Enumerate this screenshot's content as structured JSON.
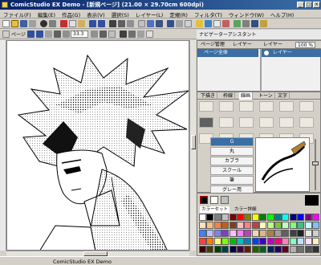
{
  "window": {
    "title": "ComicStudio EX Demo - [新規ページ] (21.00 × 29.70cm 600dpi)",
    "minimize": "_",
    "maximize": "□",
    "close": "×"
  },
  "menu": [
    "ファイル(F)",
    "編集(E)",
    "作品(G)",
    "表示(V)",
    "選択(S)",
    "レイヤー(L)",
    "定規(R)",
    "フィルタ(T)",
    "ウィンドウ(W)",
    "ヘルプ(H)"
  ],
  "toolbar2": {
    "page_label": "ページ",
    "zoom": "33.3"
  },
  "layer_panel": {
    "header": "ページ管理 レイヤー",
    "tab_navigator": "ナビゲーター",
    "tab_assistant": "アシスタント",
    "tab_page_mgmt": "ページ管理",
    "tab_layer": "レイヤー",
    "tab_layer2": "レイヤー",
    "zoom": "100 %",
    "page_item": "ページ全体",
    "layer_item": "レイヤー"
  },
  "tool_panel": {
    "tabs": [
      "下描き",
      "枠線",
      "線画",
      "トーン",
      "文字"
    ],
    "list": [
      "G",
      "丸",
      "カブラ",
      "スクール",
      "筆",
      "グレー用"
    ]
  },
  "color_panel": {
    "tab_set": "カラーセット",
    "tab_detail": "カラー詳細",
    "palette": [
      "#ffffff",
      "#000000",
      "#808080",
      "#c0c0c0",
      "#800000",
      "#ff0000",
      "#808000",
      "#ffff00",
      "#008000",
      "#00ff00",
      "#008080",
      "#00ffff",
      "#000080",
      "#0000ff",
      "#800080",
      "#ff00ff",
      "#ffe0c0",
      "#ffc080",
      "#ff8040",
      "#c06020",
      "#804020",
      "#ffc0c0",
      "#ff8080",
      "#c04040",
      "#ffffc0",
      "#c0ff80",
      "#80c040",
      "#c0ffc0",
      "#80ff80",
      "#40c080",
      "#c0ffff",
      "#80c0ff",
      "#4080ff",
      "#c0c0ff",
      "#8080ff",
      "#8040c0",
      "#ffc0ff",
      "#ff80ff",
      "#c040c0",
      "#f0d8b0",
      "#e0b880",
      "#b08040",
      "#a0a0a0",
      "#606060",
      "#404040",
      "#202020",
      "#e8e8e8",
      "#d0d0d0",
      "#ff4040",
      "#ff8000",
      "#ffff80",
      "#80ff00",
      "#00c000",
      "#00c0c0",
      "#0080c0",
      "#0040ff",
      "#4000c0",
      "#c000c0",
      "#ff0080",
      "#ff80c0",
      "#80ffc0",
      "#c0e0ff",
      "#ffe0ff",
      "#fff0c0",
      "#400000",
      "#404000",
      "#004000",
      "#004040",
      "#000040",
      "#400040",
      "#602000",
      "#206000",
      "#006020",
      "#002060",
      "#200060",
      "#600020",
      "#b0b0b0",
      "#707070",
      "#505050",
      "#303030"
    ]
  },
  "status": {
    "text": "ComicStudio EX Demo"
  },
  "colors": {
    "titlebar": "#0a246a",
    "selection": "#3a6ea5",
    "face": "#d4d0c8"
  }
}
